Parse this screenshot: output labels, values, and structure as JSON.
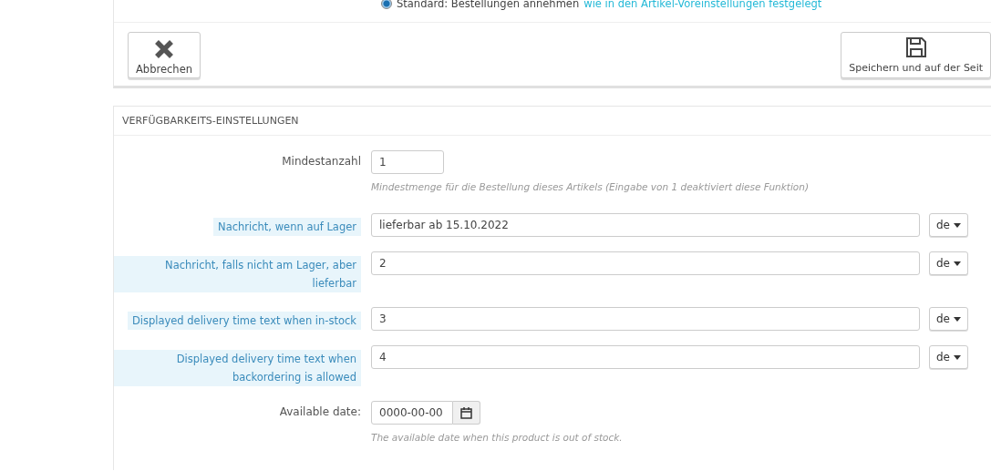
{
  "order_option": {
    "selected": true,
    "label": "Standard: Bestellungen annehmen",
    "link": "wie in den Artikel-Voreinstellungen festgelegt"
  },
  "footer_buttons": [
    {
      "kind": "cancel",
      "label": "Abbrechen"
    },
    {
      "kind": "save",
      "label": "Speichern und auf der Seit"
    }
  ],
  "availability": {
    "title": "VERFÜGBARKEITS-EINSTELLUNGEN",
    "minimum": {
      "label": "Mindestanzahl",
      "value": "1",
      "help": "Mindestmenge für die Bestellung dieses Artikels (Eingabe von 1 deaktiviert diese Funktion)"
    },
    "messages": [
      {
        "label": "Nachricht, wenn auf Lager",
        "value": "lieferbar ab 15.10.2022",
        "language": "de"
      },
      {
        "label": "Nachricht, falls nicht am Lager, aber lieferbar",
        "value": "2",
        "language": "de"
      },
      {
        "label": "Displayed delivery time text when in-stock",
        "value": "3",
        "language": "de"
      },
      {
        "label": "Displayed delivery time text when backordering is allowed",
        "value": "4",
        "language": "de"
      }
    ],
    "available_date": {
      "label": "Available date:",
      "value": "0000-00-00",
      "help": "The available date when this product is out of stock."
    }
  }
}
